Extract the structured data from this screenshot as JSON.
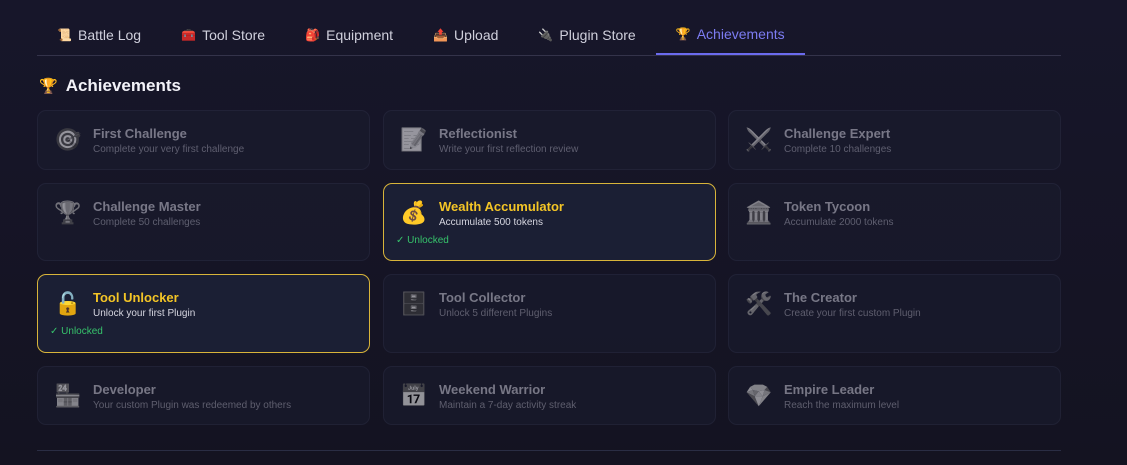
{
  "tabs": [
    {
      "label": "Battle Log",
      "icon": "📜"
    },
    {
      "label": "Tool Store",
      "icon": "🧰"
    },
    {
      "label": "Equipment",
      "icon": "🎒"
    },
    {
      "label": "Upload",
      "icon": "📤"
    },
    {
      "label": "Plugin Store",
      "icon": "🔌"
    },
    {
      "label": "Achievements",
      "icon": "🏆"
    }
  ],
  "section": {
    "title": "Achievements",
    "icon": "🏆"
  },
  "achievements": [
    {
      "title": "First Challenge",
      "desc": "Complete your very first challenge",
      "icon": "🎯"
    },
    {
      "title": "Reflectionist",
      "desc": "Write your first reflection review",
      "icon": "📝"
    },
    {
      "title": "Challenge Expert",
      "desc": "Complete 10 challenges",
      "icon": "⚔️"
    },
    {
      "title": "Challenge Master",
      "desc": "Complete 50 challenges",
      "icon": "🏆"
    },
    {
      "title": "Wealth Accumulator",
      "desc": "Accumulate 500 tokens",
      "icon": "💰",
      "status": "✓ Unlocked"
    },
    {
      "title": "Token Tycoon",
      "desc": "Accumulate 2000 tokens",
      "icon": "🏛️"
    },
    {
      "title": "Tool Unlocker",
      "desc": "Unlock your first Plugin",
      "icon": "🔓",
      "status": "✓ Unlocked"
    },
    {
      "title": "Tool Collector",
      "desc": "Unlock 5 different Plugins",
      "icon": "🗄️"
    },
    {
      "title": "The Creator",
      "desc": "Create your first custom Plugin",
      "icon": "🛠️"
    },
    {
      "title": "Developer",
      "desc": "Your custom Plugin was redeemed by others",
      "icon": "🏪"
    },
    {
      "title": "Weekend Warrior",
      "desc": "Maintain a 7-day activity streak",
      "icon": "📅"
    },
    {
      "title": "Empire Leader",
      "desc": "Reach the maximum level",
      "icon": "💎"
    }
  ]
}
